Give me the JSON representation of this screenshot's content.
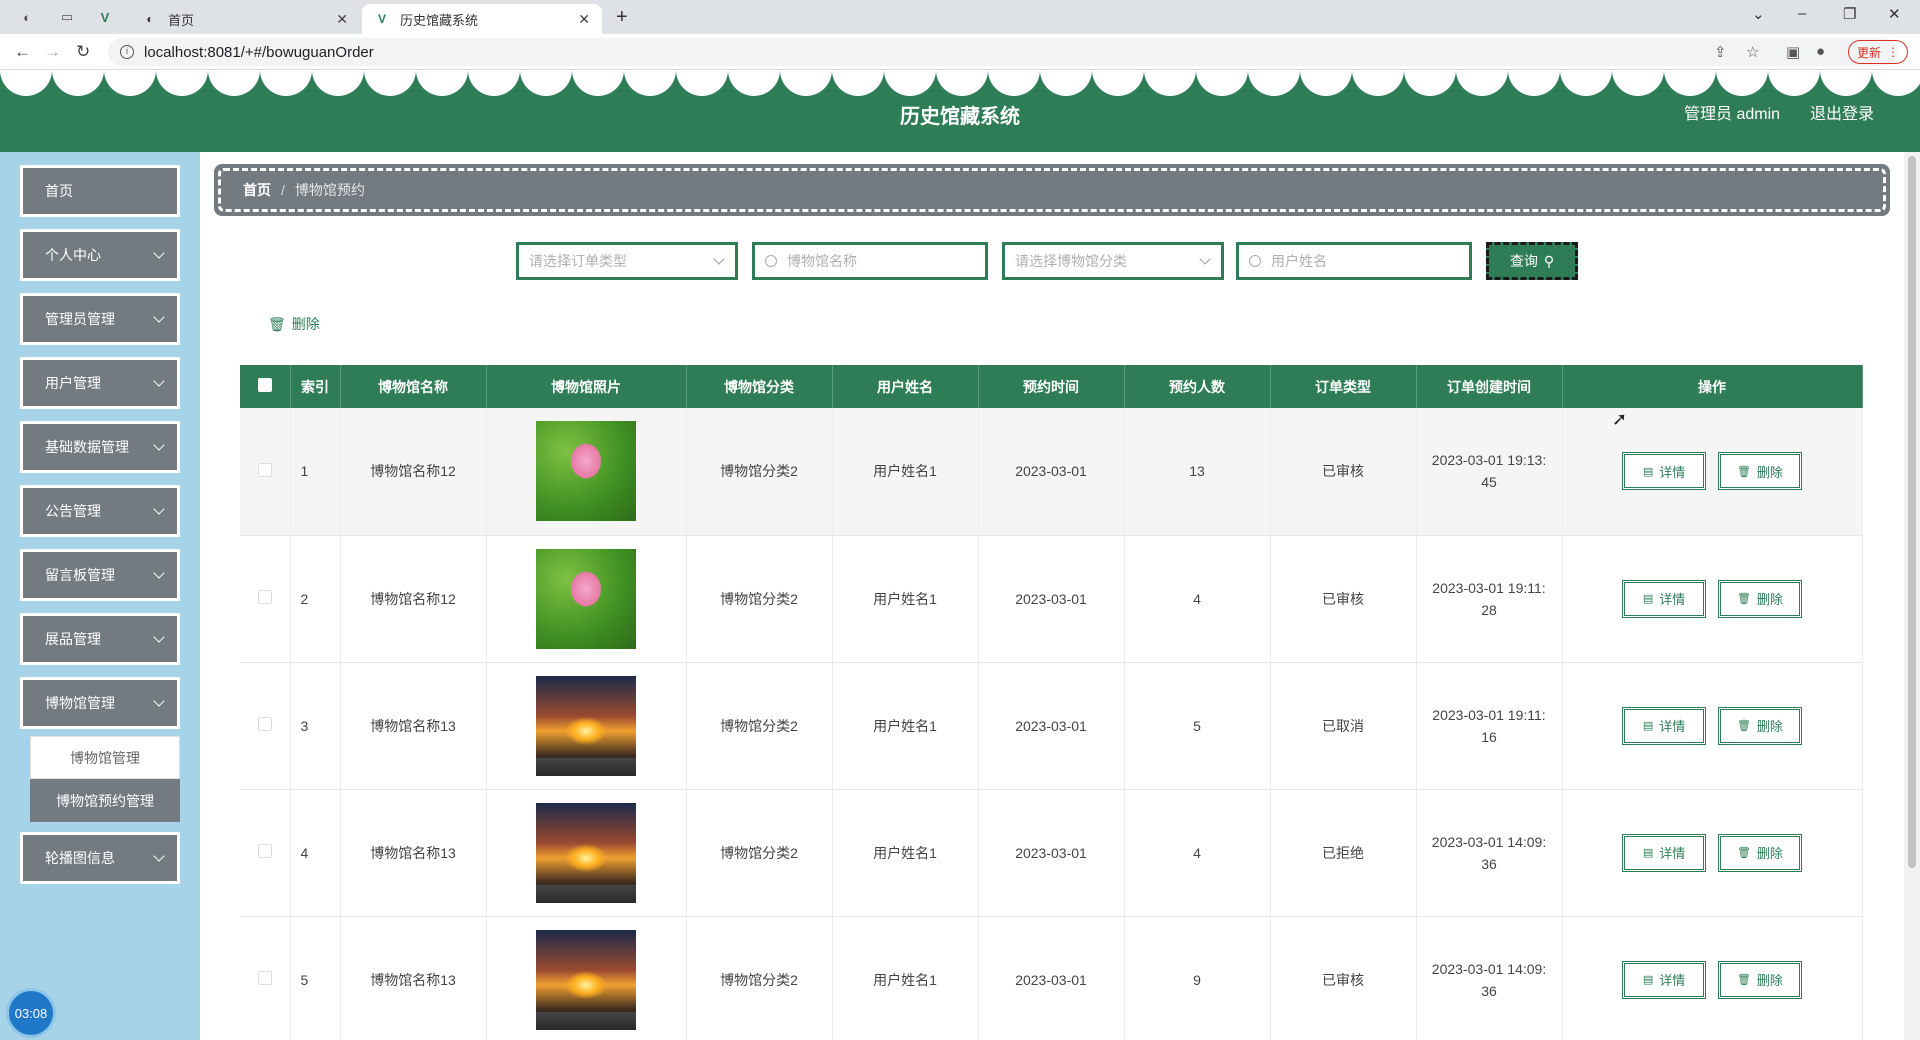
{
  "browser": {
    "tabs": [
      {
        "title": "首页",
        "active": false
      },
      {
        "title": "历史馆藏系统",
        "active": true
      }
    ],
    "url": "localhost:8081/+#/bowuguanOrder",
    "update_label": "更新"
  },
  "header": {
    "title": "历史馆藏系统",
    "user": "管理员 admin",
    "logout": "退出登录"
  },
  "sidebar": {
    "items": [
      {
        "label": "首页",
        "expandable": false
      },
      {
        "label": "个人中心",
        "expandable": true
      },
      {
        "label": "管理员管理",
        "expandable": true
      },
      {
        "label": "用户管理",
        "expandable": true
      },
      {
        "label": "基础数据管理",
        "expandable": true
      },
      {
        "label": "公告管理",
        "expandable": true
      },
      {
        "label": "留言板管理",
        "expandable": true
      },
      {
        "label": "展品管理",
        "expandable": true
      },
      {
        "label": "博物馆管理",
        "expandable": true
      },
      {
        "label": "轮播图信息",
        "expandable": true
      }
    ],
    "submenu": [
      "博物馆管理",
      "博物馆预约管理"
    ],
    "clock": "03:08"
  },
  "breadcrumb": {
    "home": "首页",
    "sep": "/",
    "current": "博物馆预约"
  },
  "search": {
    "order_type_placeholder": "请选择订单类型",
    "name_placeholder": "博物馆名称",
    "category_placeholder": "请选择博物馆分类",
    "user_placeholder": "用户姓名",
    "button": "查询"
  },
  "toolbar": {
    "delete_label": "删除"
  },
  "table": {
    "columns": [
      "索引",
      "博物馆名称",
      "博物馆照片",
      "博物馆分类",
      "用户姓名",
      "预约时间",
      "预约人数",
      "订单类型",
      "订单创建时间",
      "操作"
    ],
    "rows": [
      {
        "index": "1",
        "name": "博物馆名称12",
        "photo": "lotus",
        "category": "博物馆分类2",
        "user": "用户姓名1",
        "date": "2023-03-01",
        "count": "13",
        "status": "已审核",
        "created_1": "2023-03-01 19:13:",
        "created_2": "45"
      },
      {
        "index": "2",
        "name": "博物馆名称12",
        "photo": "lotus",
        "category": "博物馆分类2",
        "user": "用户姓名1",
        "date": "2023-03-01",
        "count": "4",
        "status": "已审核",
        "created_1": "2023-03-01 19:11:",
        "created_2": "28"
      },
      {
        "index": "3",
        "name": "博物馆名称13",
        "photo": "sunset",
        "category": "博物馆分类2",
        "user": "用户姓名1",
        "date": "2023-03-01",
        "count": "5",
        "status": "已取消",
        "created_1": "2023-03-01 19:11:",
        "created_2": "16"
      },
      {
        "index": "4",
        "name": "博物馆名称13",
        "photo": "sunset",
        "category": "博物馆分类2",
        "user": "用户姓名1",
        "date": "2023-03-01",
        "count": "4",
        "status": "已拒绝",
        "created_1": "2023-03-01 14:09:",
        "created_2": "36"
      },
      {
        "index": "5",
        "name": "博物馆名称13",
        "photo": "sunset",
        "category": "博物馆分类2",
        "user": "用户姓名1",
        "date": "2023-03-01",
        "count": "9",
        "status": "已审核",
        "created_1": "2023-03-01 14:09:",
        "created_2": "36"
      }
    ],
    "detail_label": "详情",
    "delete_label": "删除"
  },
  "colors": {
    "primary": "#2e7d56",
    "menu": "#737a80",
    "sidebar_bg": "#a7d3e8"
  }
}
